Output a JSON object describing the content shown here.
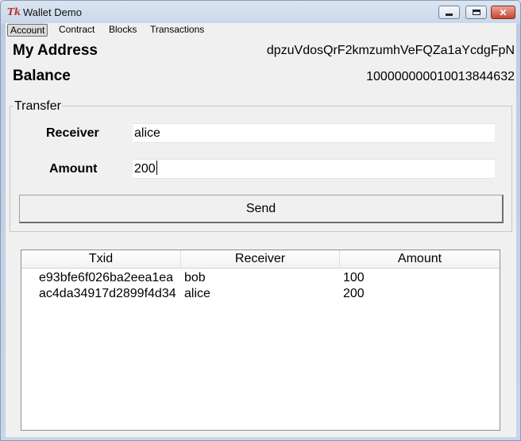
{
  "window": {
    "title": "Wallet Demo",
    "icon": "tk-feather-icon",
    "controls": [
      "minimize",
      "maximize",
      "close"
    ],
    "close_glyph": "✕"
  },
  "tabs": [
    {
      "label": "Account",
      "active": true
    },
    {
      "label": "Contract",
      "active": false
    },
    {
      "label": "Blocks",
      "active": false
    },
    {
      "label": "Transactions",
      "active": false
    }
  ],
  "account": {
    "address_label": "My Address",
    "address_value": "dpzuVdosQrF2kmzumhVeFQZa1aYcdgFpN",
    "balance_label": "Balance",
    "balance_value": "100000000010013844632"
  },
  "transfer": {
    "group_title": "Transfer",
    "receiver_label": "Receiver",
    "receiver_value": "alice",
    "amount_label": "Amount",
    "amount_value": "200",
    "send_label": "Send"
  },
  "table": {
    "columns": [
      "Txid",
      "Receiver",
      "Amount"
    ],
    "rows": [
      {
        "txid": "e93bfe6f026ba2eea1ea",
        "receiver": "bob",
        "amount": "100"
      },
      {
        "txid": "ac4da34917d2899f4d34",
        "receiver": "alice",
        "amount": "200"
      }
    ]
  },
  "colors": {
    "title_gradient_top": "#dbe5f1",
    "close_button": "#c9472f",
    "client_bg": "#f0f0f0"
  }
}
